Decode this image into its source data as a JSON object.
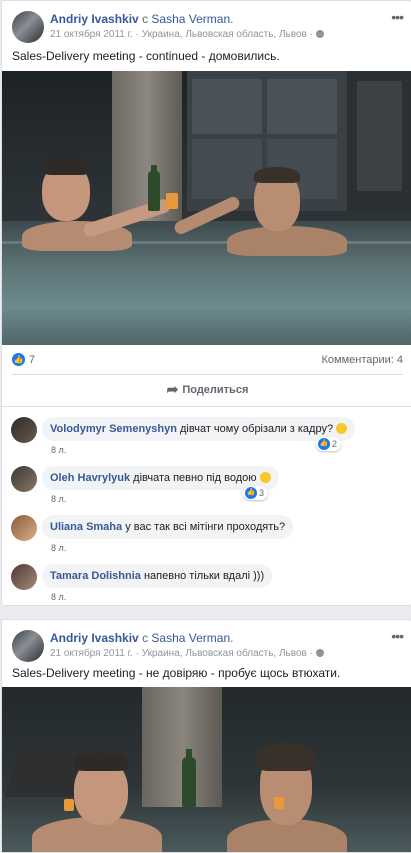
{
  "posts": [
    {
      "author": "Andriy Ivashkiv",
      "with_word": "с",
      "partner": "Sasha Verman.",
      "meta": "21 октября 2011 г. · Украина, Львовская область, Львов ·",
      "privacy_icon": "globe-icon",
      "more": "•••",
      "text": "Sales-Delivery meeting - continued - домовились.",
      "likes": "7",
      "comments_label": "Комментарии: 4",
      "share_label": "Поделиться",
      "comments": [
        {
          "author": "Volodymyr Semenyshyn",
          "text": "дівчат чому обрізали з кадру?",
          "emoji": true,
          "time": "8 л.",
          "reactions": "2"
        },
        {
          "author": "Oleh Havrylyuk",
          "text": "дівчата певно під водою",
          "emoji": true,
          "time": "8 л.",
          "reactions": "3"
        },
        {
          "author": "Uliana Smaha",
          "text": "у вас так всі мітінги проходять?",
          "emoji": false,
          "time": "8 л.",
          "reactions": ""
        },
        {
          "author": "Tamara Dolishnia",
          "text": "напевно тільки вдалі )))",
          "emoji": false,
          "time": "8 л.",
          "reactions": ""
        }
      ]
    },
    {
      "author": "Andriy Ivashkiv",
      "with_word": "с",
      "partner": "Sasha Verman.",
      "meta": "21 октября 2011 г. · Украина, Львовская область, Львов ·",
      "privacy_icon": "globe-icon",
      "more": "•••",
      "text": "Sales-Delivery meeting - не довіряю - пробує щось втюхати."
    }
  ],
  "colors": {
    "link": "#365899",
    "like": "#1877f2",
    "bubble": "#f2f3f5",
    "page_bg": "#e9ebee"
  }
}
